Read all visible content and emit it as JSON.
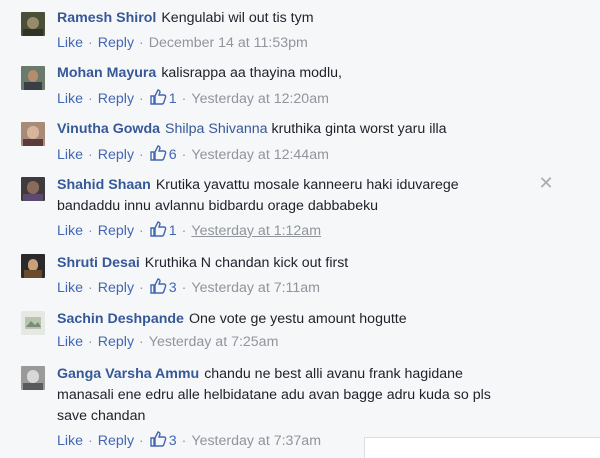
{
  "labels": {
    "like": "Like",
    "reply": "Reply",
    "separator": "·"
  },
  "comments": [
    {
      "author": "Ramesh Shirol",
      "tag": "",
      "text": "Kengulabi wil out tis tym",
      "likes": "",
      "time": "December 14 at 11:53pm"
    },
    {
      "author": "Mohan Mayura",
      "tag": "",
      "text": "kalisrappa aa thayina modlu,",
      "likes": "1",
      "time": "Yesterday at 12:20am"
    },
    {
      "author": "Vinutha Gowda",
      "tag": "Shilpa Shivanna",
      "text": "kruthika ginta worst yaru illa",
      "likes": "6",
      "time": "Yesterday at 12:44am"
    },
    {
      "author": "Shahid Shaan",
      "tag": "",
      "text": "Krutika yavattu mosale kanneeru haki iduvaregе bandaddu innu avlannu bidbardu orage dabbabeku",
      "likes": "1",
      "time": "Yesterday at 1:12am"
    },
    {
      "author": "Shruti Desai",
      "tag": "",
      "text": "Kruthika N chandan kick out first",
      "likes": "3",
      "time": "Yesterday at 7:11am"
    },
    {
      "author": "Sachin Deshpande",
      "tag": "",
      "text": "One vote ge yestu amount hogutte",
      "likes": "",
      "time": "Yesterday at 7:25am"
    },
    {
      "author": "Ganga Varsha Ammu",
      "tag": "",
      "text": "chandu ne best alli avanu frank hagidane manasali ene edru alle helbidatane adu avan bagge adru kuda so pls save chandan",
      "likes": "3",
      "time": "Yesterday at 7:37am"
    }
  ],
  "icons": {
    "close": "close-icon",
    "like": "thumbs-up-icon"
  }
}
